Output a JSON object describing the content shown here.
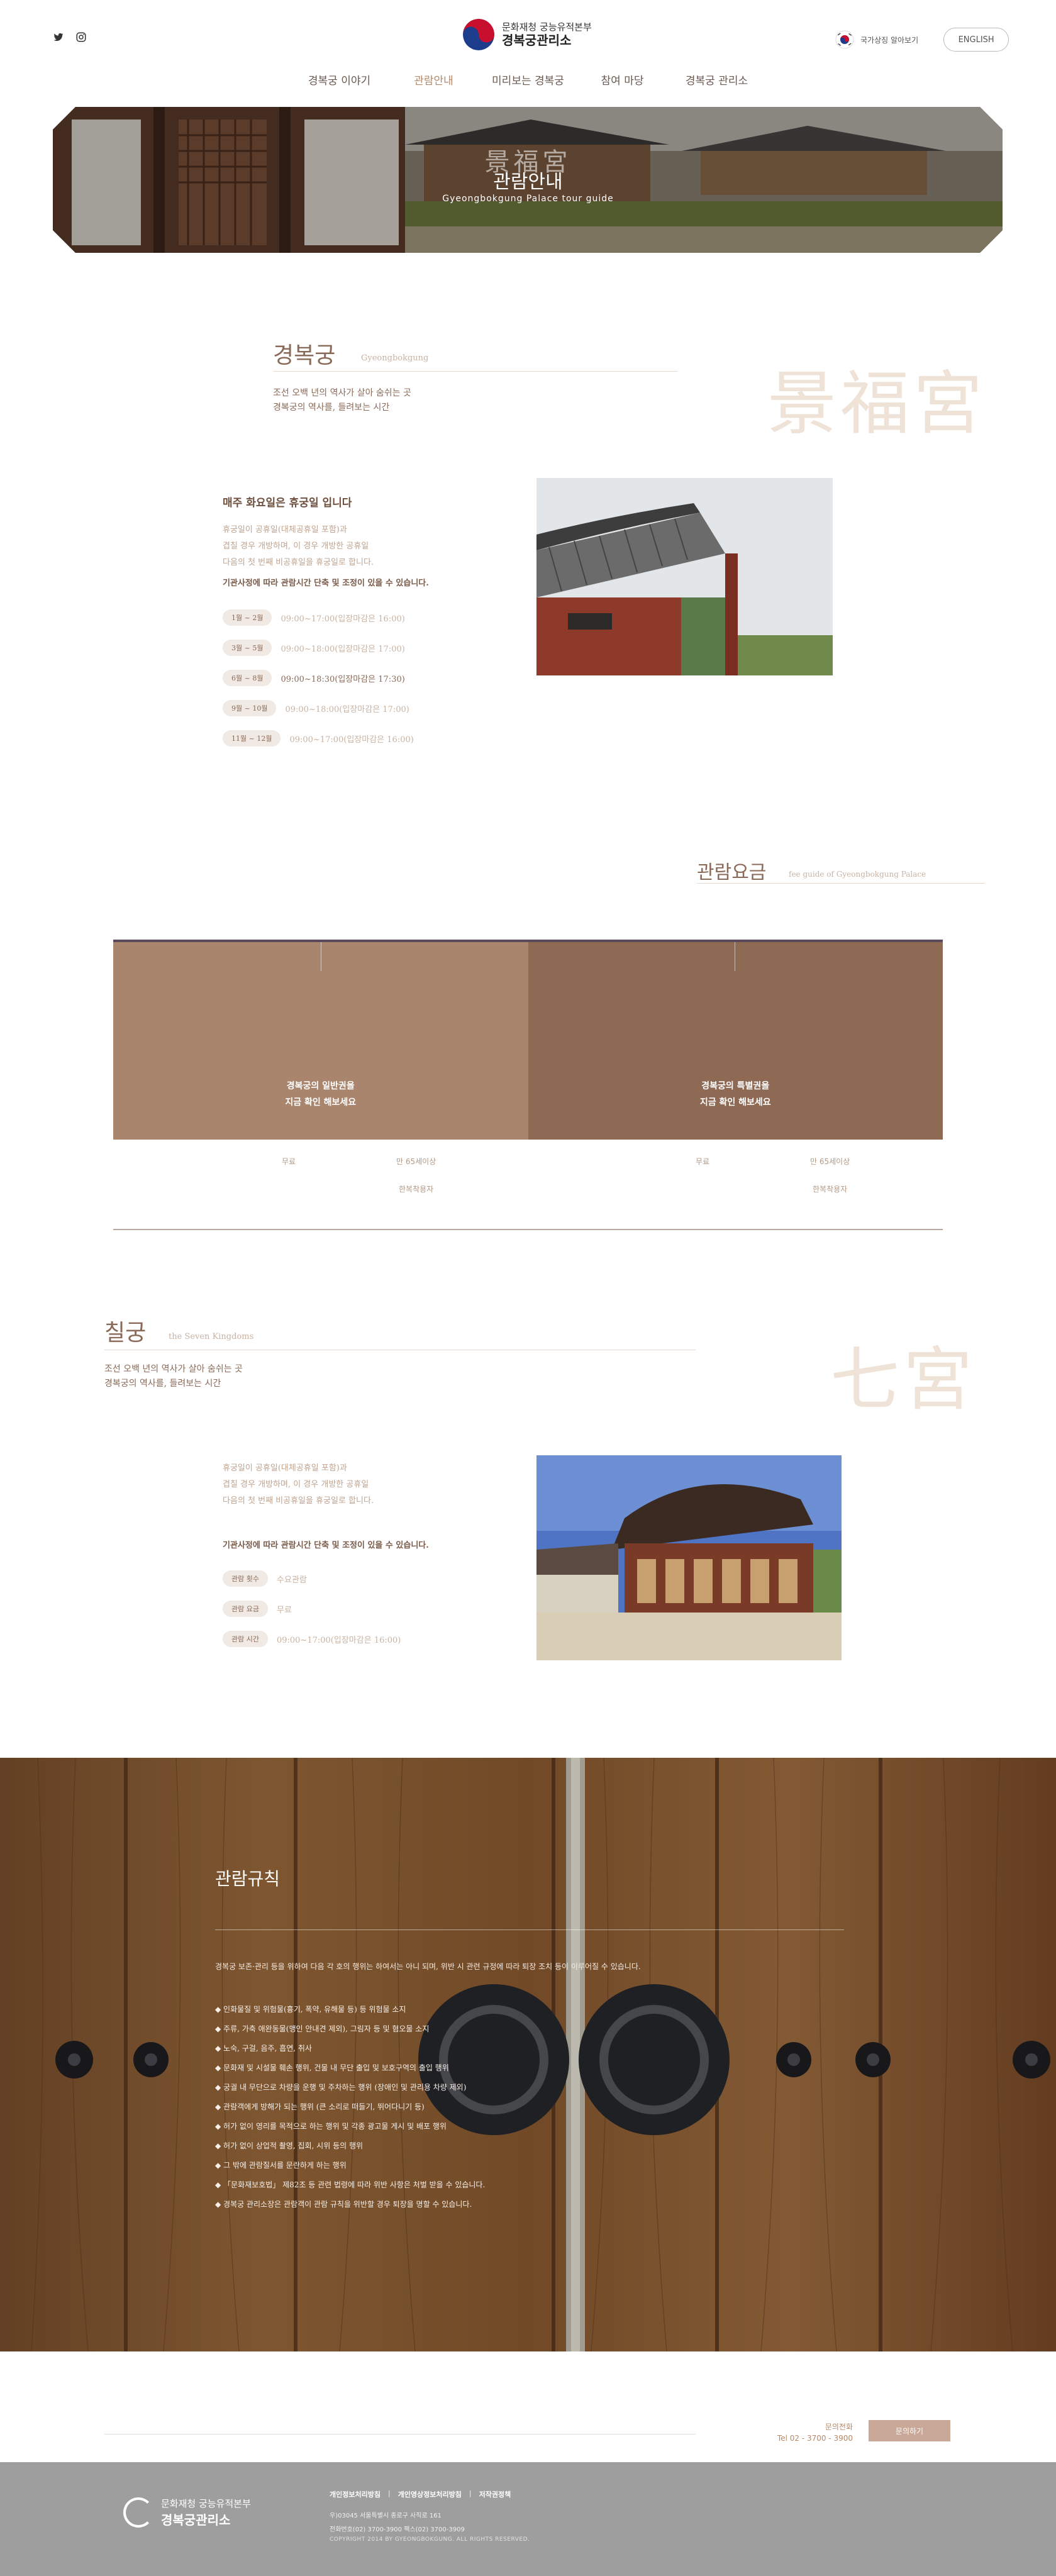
{
  "header": {
    "logo_sub": "문화재청 궁능유적본부",
    "logo_main": "경복궁관리소",
    "flag_text": "국가상징 알아보기",
    "english_label": "ENGLISH",
    "nav": [
      {
        "label": "경복궁 이야기"
      },
      {
        "label": "관람안내"
      },
      {
        "label": "미리보는 경복궁"
      },
      {
        "label": "참여 마당"
      },
      {
        "label": "경복궁 관리소"
      }
    ],
    "active_nav": 1
  },
  "hero": {
    "title_hanja": "景福宮",
    "title": "관람안내",
    "subtitle": "Gyeongbokgung Palace tour guide"
  },
  "intro": {
    "title": "경복궁",
    "eng": "Gyeongbokgung",
    "desc_line1": "조선 오백 년의 역사가 살아 숨쉬는 곳",
    "desc_line2": "경복궁의 역사를, 들려보는 시간",
    "hanja": "景福宮"
  },
  "hours": {
    "heading": "매주 화요일은 휴궁일 입니다",
    "para_lines": [
      "휴궁일이 공휴일(대체공휴일 포함)과",
      "겹칠 경우 개방하며, 이 경우 개방한 공휴일",
      "다음의 첫 번째 비공휴일을 휴궁일로 합니다."
    ],
    "strong_line": "기관사정에 따라 관람시간 단축 및 조정이 있을 수 있습니다.",
    "rows": [
      {
        "months": "1월 ~ 2월",
        "time": "09:00~17:00(입장마감은 16:00)"
      },
      {
        "months": "3월 ~ 5월",
        "time": "09:00~18:00(입장마감은 17:00)"
      },
      {
        "months": "6월 ~ 8월",
        "time": "09:00~18:30(입장마감은 17:30)"
      },
      {
        "months": "9월 ~ 10월",
        "time": "09:00~18:00(입장마감은 17:00)"
      },
      {
        "months": "11월 ~ 12월",
        "time": "09:00~17:00(입장마감은 16:00)"
      }
    ],
    "highlight_row": 2
  },
  "fees": {
    "title": "관람요금",
    "eng": "fee guide of Gyeongbokgung Palace",
    "cards": [
      {
        "line1": "경복궁의 일반권을",
        "line2": "지금 확인 해보세요",
        "label_a": "무료",
        "label_b": "만 65세이상",
        "label_c": "한복착용자"
      },
      {
        "line1": "경복궁의 특별권을",
        "line2": "지금 확인 해보세요",
        "label_a": "무료",
        "label_b": "만 65세이상",
        "label_c": "한복착용자"
      }
    ]
  },
  "chilgung": {
    "title": "칠궁",
    "eng": "the Seven Kingdoms",
    "desc_line1": "조선 오백 년의 역사가 살아 숨쉬는 곳",
    "desc_line2": "경복궁의 역사를, 들려보는 시간",
    "hanja": "七宮",
    "para_lines": [
      "휴궁일이 공휴일(대체공휴일 포함)과",
      "겹칠 경우 개방하며, 이 경우 개방한 공휴일",
      "다음의 첫 번째 비공휴일을 휴궁일로 합니다."
    ],
    "strong_line": "기관사정에 따라 관람시간 단축 및 조정이 있을 수 있습니다.",
    "rows": [
      {
        "label": "관람 횟수",
        "value": "수요관람"
      },
      {
        "label": "관람 요금",
        "value": "무료"
      },
      {
        "label": "관람 시간",
        "value": "09:00~17:00(입장마감은 16:00)"
      }
    ]
  },
  "rules": {
    "title": "관람규칙",
    "intro": "경복궁 보존·관리 등을 위하여 다음 각 호의 행위는 하여서는 아니 되며, 위반 시 관련 규정에 따라 퇴장 조치 등이 이루어질 수 있습니다.",
    "items": [
      "◆ 인화물질 및 위험물(흉기, 폭약, 유해물 등) 등 위험물 소지",
      "◆ 주류, 가축 애완동물(맹인 안내견 제외), 그림자 등 및 혐오물 소지",
      "◆ 노숙, 구걸, 음주, 흡연, 취사",
      "◆ 문화재 및 시설물 훼손 행위, 건물 내 무단 출입 및 보호구역의 출입 행위",
      "◆ 궁궐 내 무단으로 차량을 운행 및 주차하는 행위 (장애인 및 관리용 차량 제외)",
      "◆ 관람객에게 방해가 되는 행위 (큰 소리로 떠들기, 뛰어다니기 등)",
      "◆ 허가 없이 영리를 목적으로 하는 행위 및 각종 광고물 게시 및 배포 행위",
      "◆ 허가 없이 상업적 촬영, 집회, 시위 등의 행위",
      "◆ 그 밖에 관람질서를 문란하게 하는 행위",
      "◆ 「문화재보호법」 제82조 등 관련 법령에 따라 위반 사항은 처벌 받을 수 있습니다.",
      "◆ 경복궁 관리소장은 관람객이 관람 규칙을 위반할 경우 퇴장을 명할 수 있습니다."
    ]
  },
  "contact": {
    "label": "문의전화",
    "tel": "Tel 02 - 3700 - 3900",
    "button": "문의하기"
  },
  "footer": {
    "logo_sub": "문화재청 궁능유적본부",
    "logo_main": "경복궁관리소",
    "links": [
      "개인정보처리방침",
      "개인영상정보처리방침",
      "저작권정책"
    ],
    "address": "우)03045 서울특별시 종로구 사직로 161",
    "phone": "전화번호(02) 3700-3900 팩스(02) 3700-3909",
    "copyright": "COPYRIGHT 2014 BY GYEONGBOKGUNG. ALL RIGHTS RESERVED."
  },
  "colors": {
    "accent": "#b58a6a",
    "brown_text": "#8a6a58",
    "fee_card": "#a8856c",
    "footer_bg": "#9e9e9e"
  }
}
